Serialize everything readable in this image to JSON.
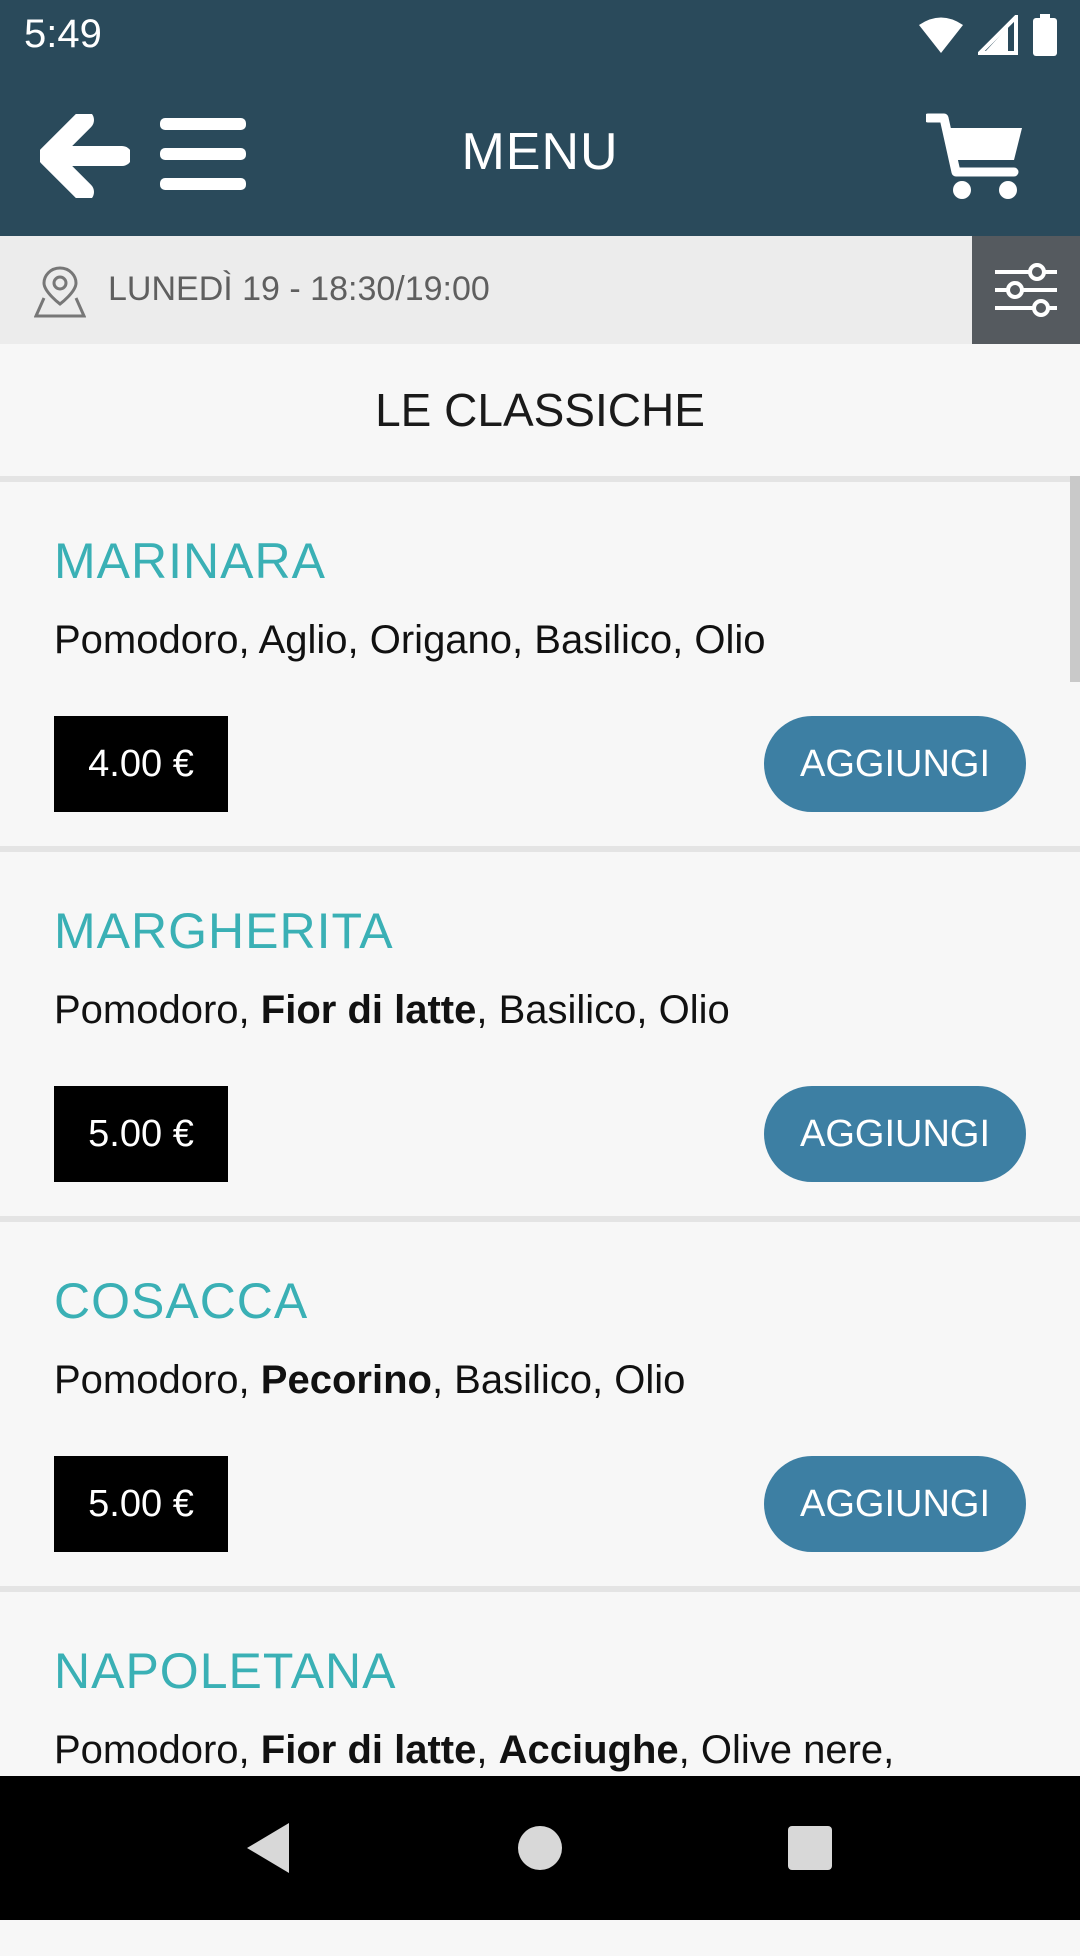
{
  "status_bar": {
    "time": "5:49",
    "icons": [
      "wifi-icon",
      "cell-signal-icon",
      "battery-icon"
    ]
  },
  "app_bar": {
    "title": "MENU",
    "icons": [
      "back-arrow-icon",
      "hamburger-menu-icon",
      "cart-icon"
    ]
  },
  "info_bar": {
    "date_time": "LUNEDÌ 19 - 18:30/19:00",
    "icons": [
      "map-pin-icon",
      "filter-sliders-icon"
    ]
  },
  "section": {
    "title": "LE CLASSICHE"
  },
  "items": [
    {
      "name": "MARINARA",
      "desc": [
        {
          "text": "Pomodoro, Aglio, Origano, Basilico, Olio",
          "bold": false
        }
      ],
      "price": "4.00 €",
      "button": "AGGIUNGI"
    },
    {
      "name": "MARGHERITA",
      "desc": [
        {
          "text": "Pomodoro, ",
          "bold": false
        },
        {
          "text": "Fior di latte",
          "bold": true
        },
        {
          "text": ", Basilico, Olio",
          "bold": false
        }
      ],
      "price": "5.00 €",
      "button": "AGGIUNGI"
    },
    {
      "name": "COSACCA",
      "desc": [
        {
          "text": "Pomodoro, ",
          "bold": false
        },
        {
          "text": "Pecorino",
          "bold": true
        },
        {
          "text": ", Basilico, Olio",
          "bold": false
        }
      ],
      "price": "5.00 €",
      "button": "AGGIUNGI"
    },
    {
      "name": "NAPOLETANA",
      "desc": [
        {
          "text": "Pomodoro, ",
          "bold": false
        },
        {
          "text": "Fior di latte",
          "bold": true
        },
        {
          "text": ", ",
          "bold": false
        },
        {
          "text": "Acciughe",
          "bold": true
        },
        {
          "text": ", Olive nere,",
          "bold": false
        }
      ],
      "price": "",
      "button": ""
    }
  ],
  "colors": {
    "header": "#2a4a5b",
    "item_name": "#3ab0b5",
    "add_button": "#3d7fa3",
    "price_badge": "#000000"
  },
  "nav_bar": {
    "icons": [
      "nav-back-icon",
      "nav-home-icon",
      "nav-recents-icon"
    ]
  }
}
